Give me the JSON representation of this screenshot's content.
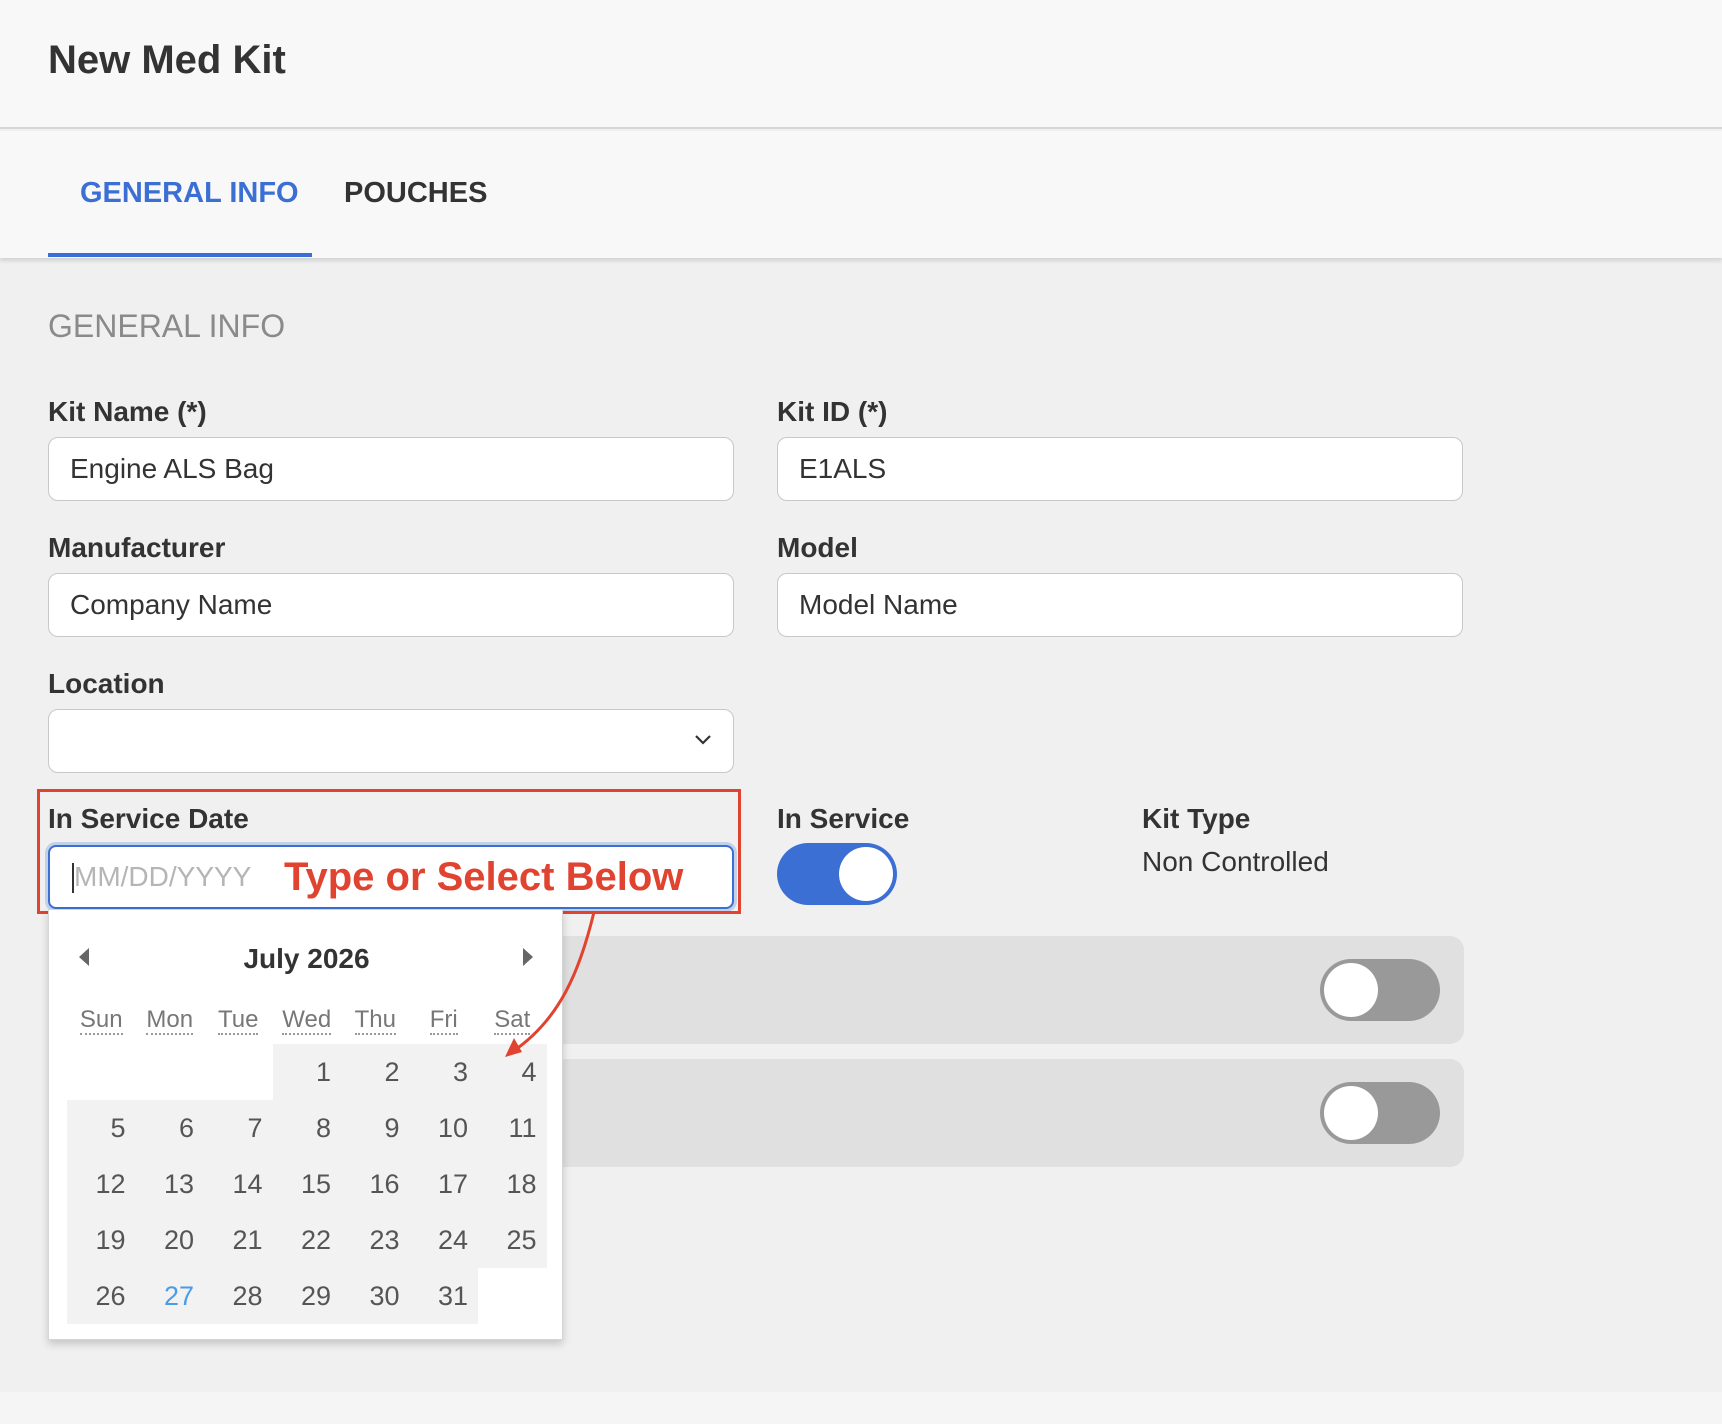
{
  "header": {
    "title": "New Med Kit"
  },
  "tabs": [
    {
      "label": "GENERAL INFO",
      "active": true
    },
    {
      "label": "POUCHES",
      "active": false
    }
  ],
  "section": {
    "title": "GENERAL INFO"
  },
  "form": {
    "kit_name": {
      "label": "Kit Name (*)",
      "value": "Engine ALS Bag"
    },
    "kit_id": {
      "label": "Kit ID (*)",
      "value": "E1ALS"
    },
    "manufacturer": {
      "label": "Manufacturer",
      "value": "Company Name"
    },
    "model": {
      "label": "Model",
      "value": "Model Name"
    },
    "location": {
      "label": "Location",
      "value": ""
    },
    "in_service_date": {
      "label": "In Service Date",
      "placeholder": "MM/DD/YYYY"
    },
    "in_service": {
      "label": "In Service",
      "on": true
    },
    "kit_type": {
      "label": "Kit Type",
      "value": "Non Controlled"
    },
    "toggle_row_1": {
      "on": false
    },
    "toggle_row_2": {
      "on": false
    }
  },
  "annotation": {
    "text": "Type or Select Below",
    "color": "#e0432f"
  },
  "calendar": {
    "title": "July  2026",
    "weekdays": [
      "Sun",
      "Mon",
      "Tue",
      "Wed",
      "Thu",
      "Fri",
      "Sat"
    ],
    "weeks": [
      [
        "",
        "",
        "",
        "1",
        "2",
        "3",
        "4"
      ],
      [
        "5",
        "6",
        "7",
        "8",
        "9",
        "10",
        "11"
      ],
      [
        "12",
        "13",
        "14",
        "15",
        "16",
        "17",
        "18"
      ],
      [
        "19",
        "20",
        "21",
        "22",
        "23",
        "24",
        "25"
      ],
      [
        "26",
        "27",
        "28",
        "29",
        "30",
        "31",
        ""
      ]
    ],
    "today": "27"
  },
  "colors": {
    "accent": "#3b6fd4",
    "today": "#4a9be8",
    "annotation": "#e0432f"
  }
}
